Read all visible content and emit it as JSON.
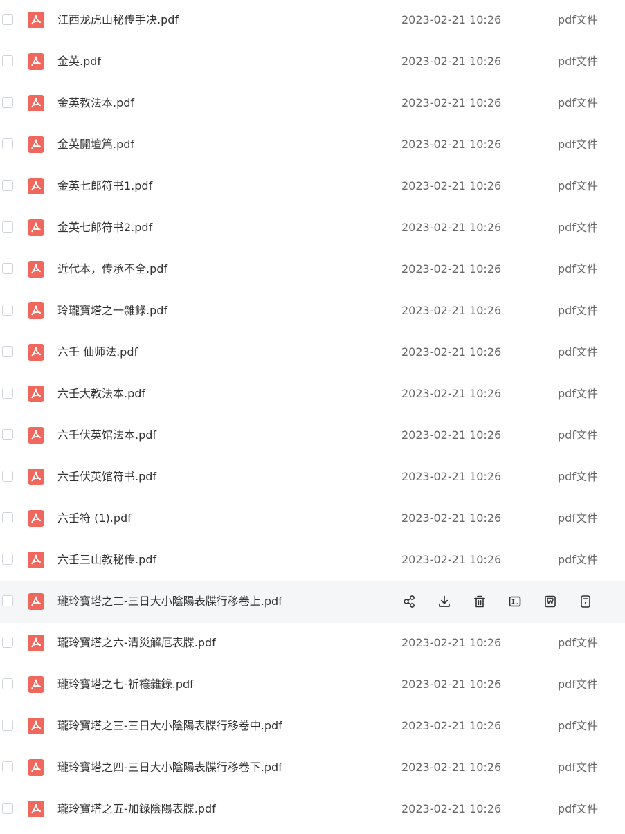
{
  "colors": {
    "pdf_icon": "#f0675d",
    "row_hover": "#f5f6f8",
    "text_primary": "#333333",
    "text_secondary": "#666666",
    "icon_stroke": "#333333"
  },
  "row_actions": [
    {
      "name": "share-icon"
    },
    {
      "name": "download-icon"
    },
    {
      "name": "delete-icon"
    },
    {
      "name": "rename-icon"
    },
    {
      "name": "convert-word-icon"
    },
    {
      "name": "more-icon"
    }
  ],
  "files": [
    {
      "name": "江西龙虎山秘传手决.pdf",
      "date": "2023-02-21 10:26",
      "type": "pdf文件",
      "hovered": false
    },
    {
      "name": "金英.pdf",
      "date": "2023-02-21 10:26",
      "type": "pdf文件",
      "hovered": false
    },
    {
      "name": "金英教法本.pdf",
      "date": "2023-02-21 10:26",
      "type": "pdf文件",
      "hovered": false
    },
    {
      "name": "金英開壇篇.pdf",
      "date": "2023-02-21 10:26",
      "type": "pdf文件",
      "hovered": false
    },
    {
      "name": "金英七郎符书1.pdf",
      "date": "2023-02-21 10:26",
      "type": "pdf文件",
      "hovered": false
    },
    {
      "name": "金英七郎符书2.pdf",
      "date": "2023-02-21 10:26",
      "type": "pdf文件",
      "hovered": false
    },
    {
      "name": "近代本，传承不全.pdf",
      "date": "2023-02-21 10:26",
      "type": "pdf文件",
      "hovered": false
    },
    {
      "name": "玲瓏寶塔之一雜錄.pdf",
      "date": "2023-02-21 10:26",
      "type": "pdf文件",
      "hovered": false
    },
    {
      "name": "六壬 仙师法.pdf",
      "date": "2023-02-21 10:26",
      "type": "pdf文件",
      "hovered": false
    },
    {
      "name": "六壬大教法本.pdf",
      "date": "2023-02-21 10:26",
      "type": "pdf文件",
      "hovered": false
    },
    {
      "name": "六壬伏英馆法本.pdf",
      "date": "2023-02-21 10:26",
      "type": "pdf文件",
      "hovered": false
    },
    {
      "name": "六壬伏英馆符书.pdf",
      "date": "2023-02-21 10:26",
      "type": "pdf文件",
      "hovered": false
    },
    {
      "name": "六壬符 (1).pdf",
      "date": "2023-02-21 10:26",
      "type": "pdf文件",
      "hovered": false
    },
    {
      "name": "六壬三山教秘传.pdf",
      "date": "2023-02-21 10:26",
      "type": "pdf文件",
      "hovered": false
    },
    {
      "name": "瓏玲寶塔之二-三日大小陰陽表牒行移卷上.pdf",
      "date": "",
      "type": "",
      "hovered": true
    },
    {
      "name": "瓏玲寶塔之六-清災解厄表牒.pdf",
      "date": "2023-02-21 10:26",
      "type": "pdf文件",
      "hovered": false
    },
    {
      "name": "瓏玲寶塔之七-祈禳雜錄.pdf",
      "date": "2023-02-21 10:26",
      "type": "pdf文件",
      "hovered": false
    },
    {
      "name": "瓏玲寶塔之三-三日大小陰陽表牒行移卷中.pdf",
      "date": "2023-02-21 10:26",
      "type": "pdf文件",
      "hovered": false
    },
    {
      "name": "瓏玲寶塔之四-三日大小陰陽表牒行移卷下.pdf",
      "date": "2023-02-21 10:26",
      "type": "pdf文件",
      "hovered": false
    },
    {
      "name": "瓏玲寶塔之五-加錄陰陽表牒.pdf",
      "date": "2023-02-21 10:26",
      "type": "pdf文件",
      "hovered": false
    }
  ]
}
